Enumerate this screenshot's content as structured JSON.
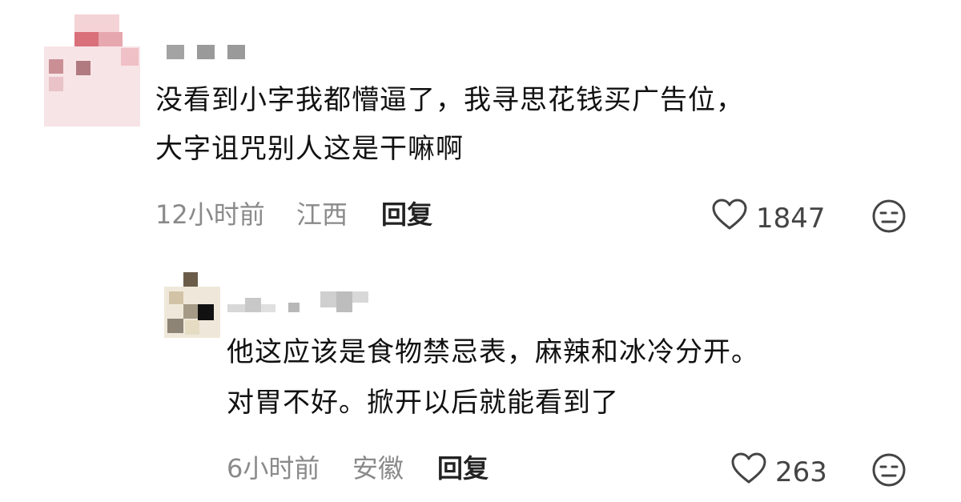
{
  "comments": [
    {
      "text_lines": [
        "没看到小字我都懵逼了，我寻思花钱买广告位，",
        "大字诅咒别人这是干嘛啊"
      ],
      "time": "12小时前",
      "location": "江西",
      "reply_label": "回复",
      "likes": "1847"
    },
    {
      "text_lines": [
        "他这应该是食物禁忌表，麻辣和冰冷分开。",
        "对胃不好。掀开以后就能看到了"
      ],
      "time": "6小时前",
      "location": "安徽",
      "reply_label": "回复",
      "likes": "263"
    }
  ],
  "icons": {
    "like": "heart-outline-icon",
    "reaction": "neutral-face-icon"
  },
  "colors": {
    "meta_text": "#8a8a8a",
    "body_text": "#111111",
    "avatar1_accent": "#d9707a"
  }
}
